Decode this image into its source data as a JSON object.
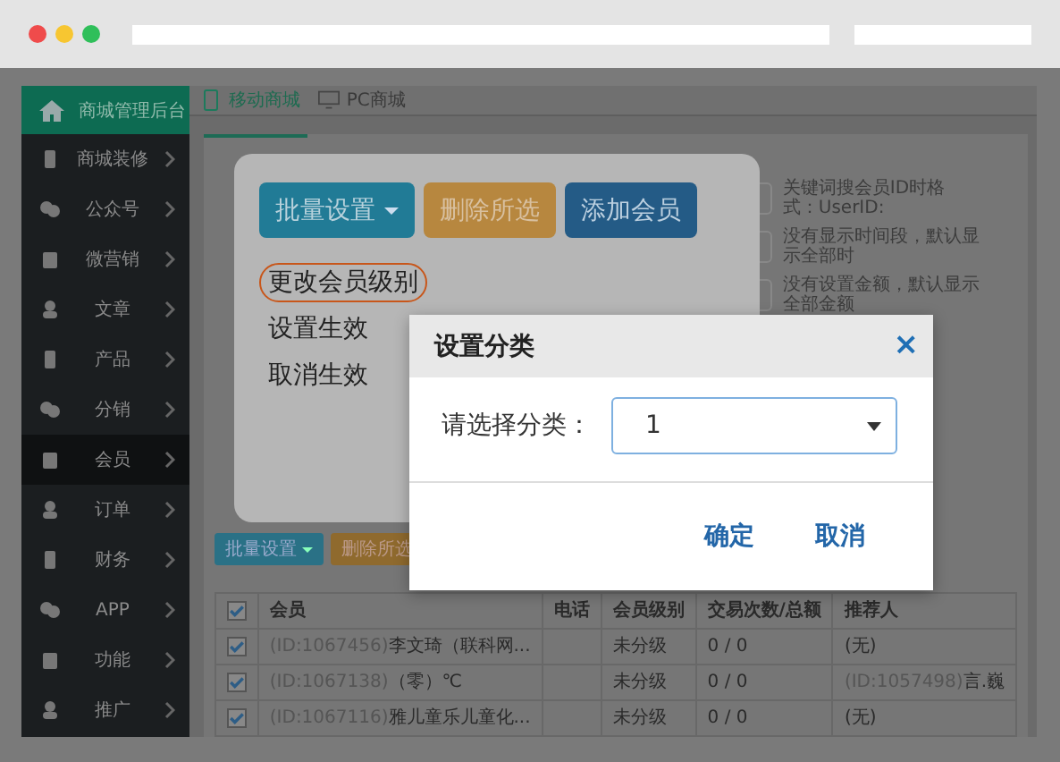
{
  "browser": {
    "dots": [
      {
        "color": "#ef4b4b"
      },
      {
        "color": "#f7c631"
      },
      {
        "color": "#2fbf5a"
      }
    ]
  },
  "sidebar": {
    "title": "商城管理后台",
    "items": [
      {
        "label": "商城装修",
        "selected": false
      },
      {
        "label": "公众号",
        "selected": false
      },
      {
        "label": "微营销",
        "selected": false
      },
      {
        "label": "文章",
        "selected": false
      },
      {
        "label": "产品",
        "selected": false
      },
      {
        "label": "分销",
        "selected": false
      },
      {
        "label": "会员",
        "selected": true
      },
      {
        "label": "订单",
        "selected": false
      },
      {
        "label": "财务",
        "selected": false
      },
      {
        "label": "APP",
        "selected": false
      },
      {
        "label": "功能",
        "selected": false
      },
      {
        "label": "推广",
        "selected": false
      }
    ]
  },
  "top_tabs": [
    {
      "label": "移动商城",
      "selected": true
    },
    {
      "label": "PC商城",
      "selected": false
    }
  ],
  "filters": [
    {
      "note": "关键词搜会员ID时格式：UserID:"
    },
    {
      "note": "没有显示时间段，默认显示全部时"
    },
    {
      "note": "没有设置金额，默认显示全部金额"
    }
  ],
  "toolbar": [
    {
      "label": "批量设置",
      "kind": "dropdown"
    },
    {
      "label": "删除所选",
      "kind": "warning"
    }
  ],
  "table": {
    "all_checked": true,
    "columns": [
      "会员",
      "电话",
      "会员级别",
      "交易次数/总额",
      "推荐人"
    ],
    "rows": [
      {
        "checked": true,
        "member_id": "(ID:1067456)",
        "member_name": "李文琦（联科网...",
        "phone": "",
        "level": "未分级",
        "trades": "0 / 0",
        "referrer_id": "",
        "referrer": "(无)"
      },
      {
        "checked": true,
        "member_id": "(ID:1067138)",
        "member_name": "（零）℃",
        "phone": "",
        "level": "未分级",
        "trades": "0 / 0",
        "referrer_id": "(ID:1057498)",
        "referrer": "言.巍"
      },
      {
        "checked": true,
        "member_id": "(ID:1067116)",
        "member_name": "雅儿童乐儿童化...",
        "phone": "",
        "level": "未分级",
        "trades": "0 / 0",
        "referrer_id": "",
        "referrer": "(无)"
      }
    ]
  },
  "callout": {
    "buttons": [
      {
        "label": "批量设置",
        "kind": "dropdown"
      },
      {
        "label": "删除所选",
        "kind": "warning"
      },
      {
        "label": "添加会员",
        "kind": "primary"
      }
    ],
    "menu": [
      {
        "label": "更改会员级别",
        "highlighted": true
      },
      {
        "label": "设置生效",
        "highlighted": false
      },
      {
        "label": "取消生效",
        "highlighted": false
      }
    ]
  },
  "dialog": {
    "title": "设置分类",
    "close": "×",
    "field_label": "请选择分类：",
    "select_value": "1",
    "buttons": [
      "确定",
      "取消"
    ]
  }
}
